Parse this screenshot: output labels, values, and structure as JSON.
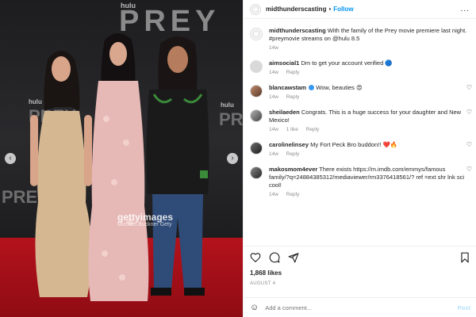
{
  "photo": {
    "backdrop_logo": "PREY",
    "backdrop_logo_small": "hulu",
    "side_logo_left": "PREY",
    "side_logo_right": "PREY",
    "side_logo_bottom": "PREY",
    "watermark_main": "gettyimages",
    "watermark_credit": "Michael Buckner Gety",
    "prev_icon": "chevron-left-icon",
    "next_icon": "chevron-right-icon"
  },
  "header": {
    "username": "midthunderscasting",
    "separator": "•",
    "follow_label": "Follow",
    "more_label": "..."
  },
  "caption": {
    "username": "midthunderscasting",
    "text": "With the family of the Prey movie premiere last night. #preymovie streams on @hulu 8.5",
    "time": "14w"
  },
  "comments": [
    {
      "username": "aimsocial1",
      "text": "Dm to get your account verified",
      "emoji": "🔵",
      "time": "14w",
      "reply": "Reply",
      "likes": ""
    },
    {
      "username": "blancawstam",
      "verified": true,
      "text": "Wow, beauties",
      "emoji": "😍",
      "time": "14w",
      "reply": "Reply",
      "likes": ""
    },
    {
      "username": "sheilaeden",
      "text": "Congrats. This is a huge success for your daughter and New Mexico!",
      "emoji": "",
      "time": "14w",
      "reply": "Reply",
      "likes": "1 like"
    },
    {
      "username": "carolinelinsey",
      "text": "My Fort Peck Bro buddon!!",
      "emoji": "❤️🔥",
      "time": "14w",
      "reply": "Reply",
      "likes": ""
    },
    {
      "username": "makosmom4ever",
      "text": "There exists https://m.imdb.com/emmys/famous family/?q=24884385312/mediaviewer/rm3376418561/? ref =ext shr lnk sci cool!",
      "emoji": "",
      "time": "14w",
      "reply": "Reply",
      "likes": ""
    }
  ],
  "actions": {
    "like_icon": "heart-icon",
    "comment_icon": "comment-icon",
    "share_icon": "send-icon",
    "save_icon": "bookmark-icon"
  },
  "likes_label": "1,868 likes",
  "date_label": "AUGUST 4",
  "add_comment": {
    "emoji_icon": "smiley-icon",
    "placeholder": "Add a comment...",
    "post_label": "Post"
  }
}
